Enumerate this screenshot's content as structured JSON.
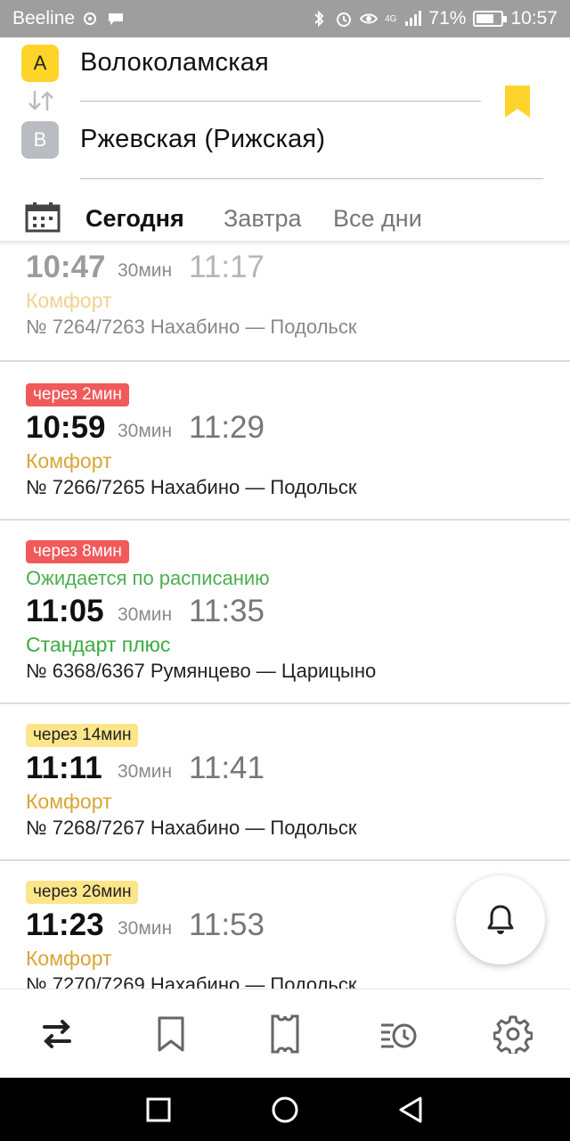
{
  "status_bar": {
    "carrier": "Beeline",
    "network": "4G",
    "battery_percent": "71%",
    "battery_level": 0.71,
    "time": "10:57"
  },
  "route": {
    "from_letter": "A",
    "to_letter": "B",
    "from_station": "Волоколамская",
    "to_station": "Ржевская  (Рижская)",
    "accent_color": "#fed42b"
  },
  "days": {
    "today": "Сегодня",
    "tomorrow": "Завтра",
    "all": "Все дни"
  },
  "trains": [
    {
      "departure": "10:47",
      "duration": "30мин",
      "arrival": "11:17",
      "class": "Комфорт",
      "route": "№ 7264/7263 Нахабино — Подольск"
    },
    {
      "badge": "через 2мин",
      "departure": "10:59",
      "duration": "30мин",
      "arrival": "11:29",
      "class": "Комфорт",
      "route": "№ 7266/7265 Нахабино — Подольск"
    },
    {
      "badge": "через 8мин",
      "status": "Ожидается по расписанию",
      "departure": "11:05",
      "duration": "30мин",
      "arrival": "11:35",
      "class": "Стандарт плюс",
      "route": "№ 6368/6367 Румянцево — Царицыно"
    },
    {
      "badge": "через 14мин",
      "departure": "11:11",
      "duration": "30мин",
      "arrival": "11:41",
      "class": "Комфорт",
      "route": "№ 7268/7267 Нахабино — Подольск"
    },
    {
      "badge": "через 26мин",
      "departure": "11:23",
      "duration": "30мин",
      "arrival": "11:53",
      "class": "Комфорт",
      "route": "№ 7270/7269 Нахабино — Подольск"
    }
  ],
  "icons": {
    "calendar": "calendar-icon",
    "bookmark": "bookmark-icon",
    "bell": "bell-icon",
    "nav": [
      "routes-icon",
      "bookmark-icon",
      "ticket-icon",
      "history-icon",
      "settings-icon"
    ]
  },
  "colors": {
    "badge_soon": "#f05a5a",
    "badge_later": "#fde58a",
    "class_comfort": "#d9a533",
    "class_standard_plus": "#3cab42"
  }
}
